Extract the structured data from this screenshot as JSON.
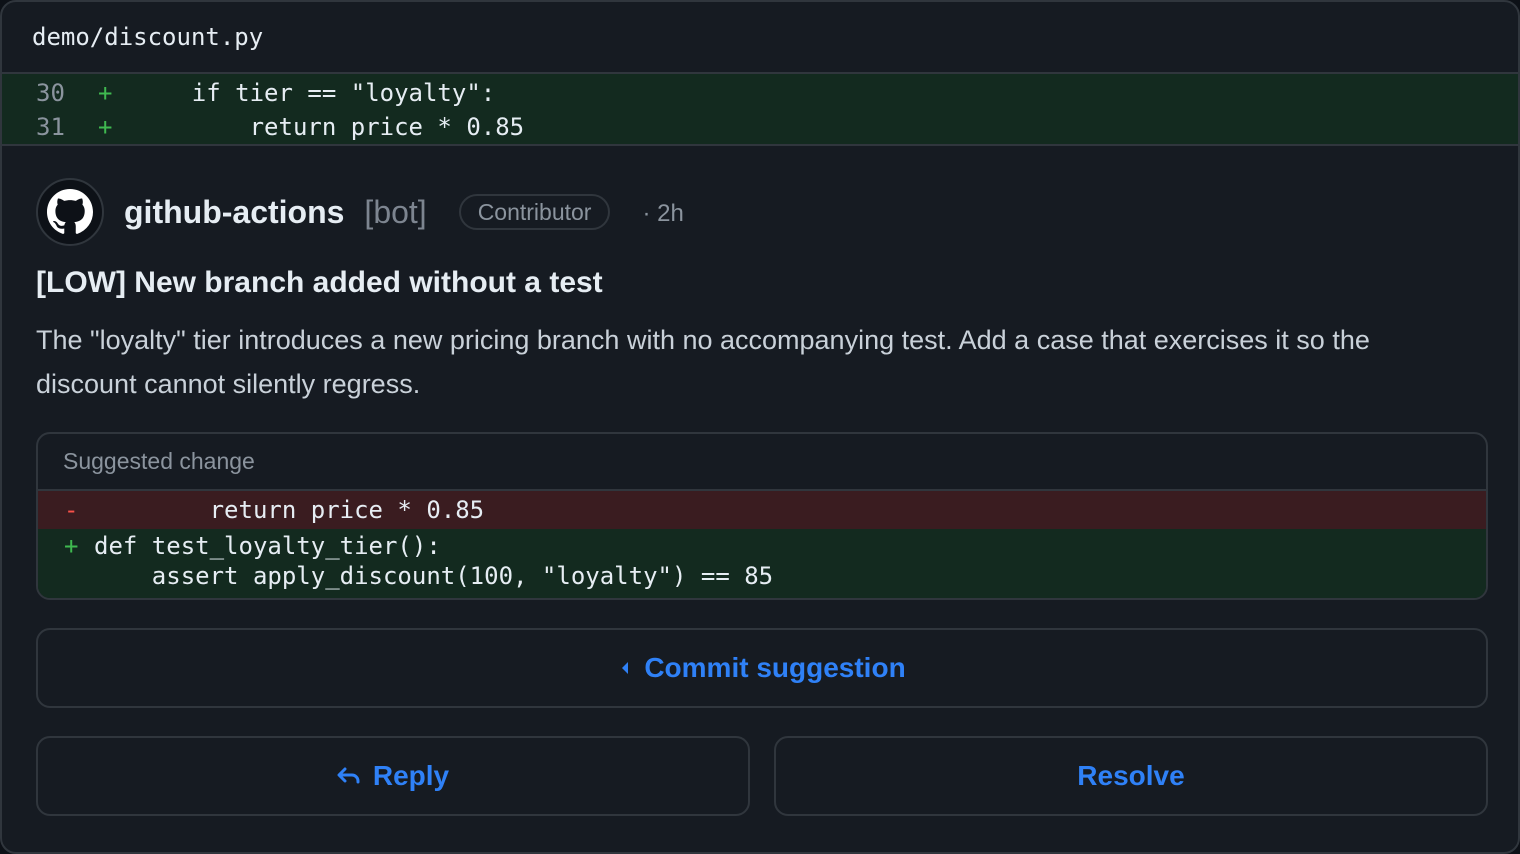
{
  "file": {
    "path": "demo/discount.py"
  },
  "diff": {
    "lines": [
      {
        "number": "30",
        "sign": "+",
        "code": "    if tier == \"loyalty\":"
      },
      {
        "number": "31",
        "sign": "+",
        "code": "        return price * 0.85"
      }
    ]
  },
  "comment": {
    "avatar_icon": "github-mark-icon",
    "author": "github-actions",
    "bot_tag": "[bot]",
    "role": "Contributor",
    "time": "· 2h",
    "title": "[LOW] New branch added without a test",
    "body": "The \"loyalty\" tier introduces a new pricing branch with no accompanying test. Add a case that exercises it so the discount cannot silently regress."
  },
  "suggestion": {
    "header": "Suggested change",
    "removed": [
      {
        "sign": "-",
        "code": "        return price * 0.85"
      }
    ],
    "added": [
      {
        "sign": "+",
        "code": "def test_loyalty_tier():"
      },
      {
        "sign": "",
        "code": "    assert apply_discount(100, \"loyalty\") == 85"
      }
    ]
  },
  "actions": {
    "commit_label": "Commit suggestion",
    "commit_icon": "commit-icon",
    "reply_label": "Reply",
    "reply_icon": "reply-arrow-icon",
    "resolve_label": "Resolve"
  },
  "colors": {
    "accent": "#2f81f7",
    "added_bg": "#132a1f",
    "removed_bg": "#3a1c20",
    "added_sign": "#3fb950",
    "removed_sign": "#f85149"
  }
}
